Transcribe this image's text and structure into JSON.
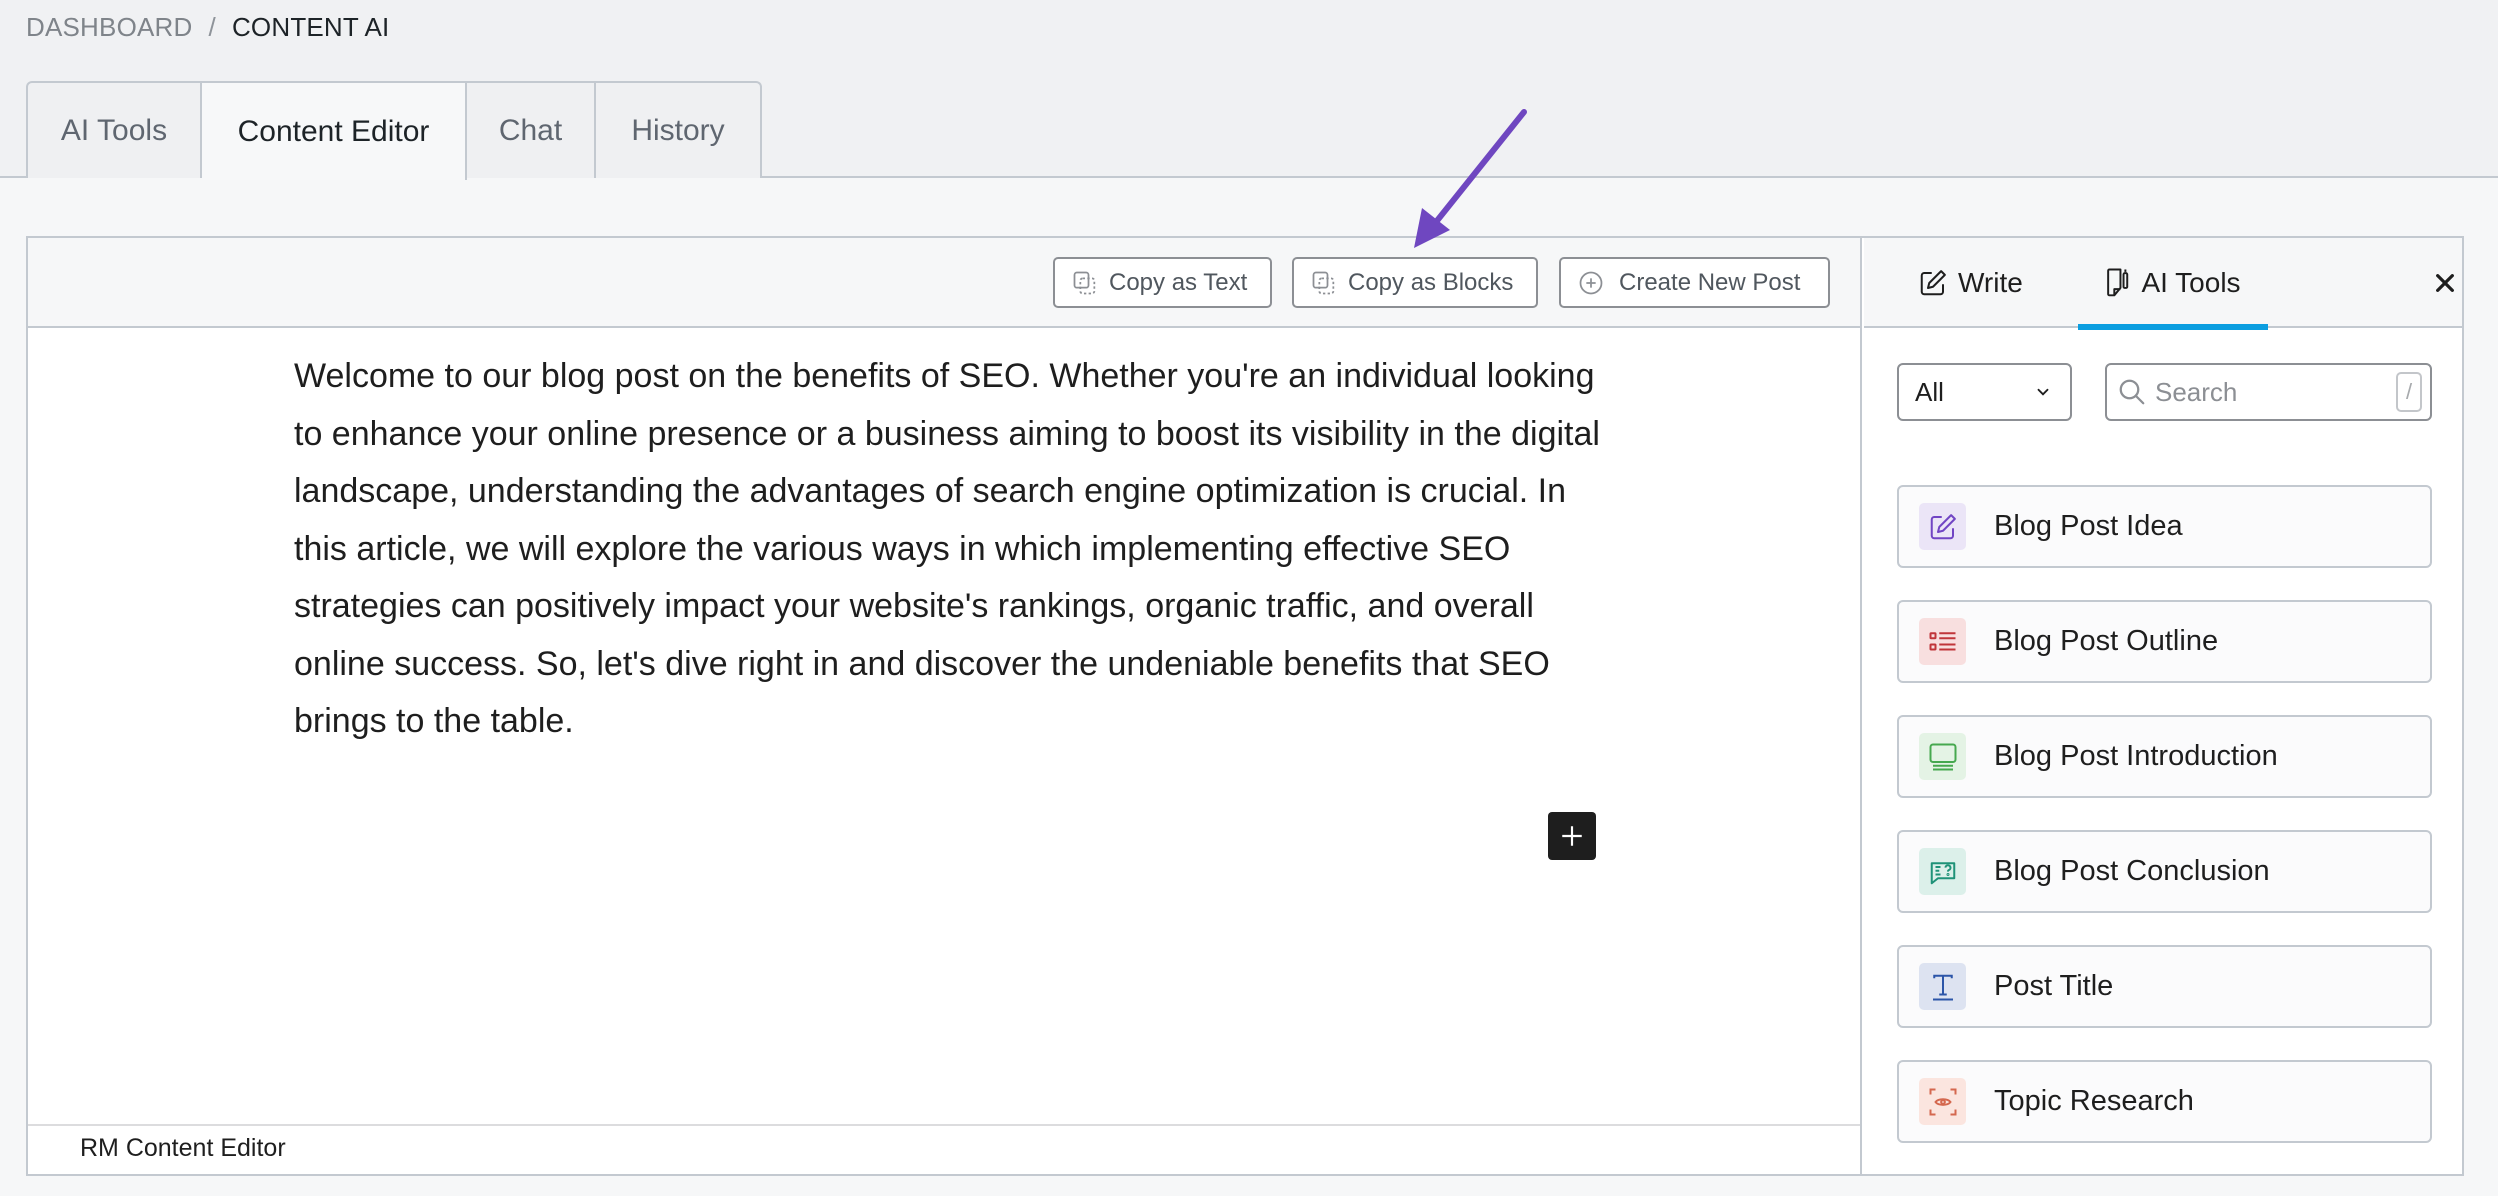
{
  "breadcrumb": {
    "parent": "DASHBOARD",
    "separator": "/",
    "current": "CONTENT AI"
  },
  "tabs": [
    {
      "label": "AI Tools",
      "active": false
    },
    {
      "label": "Content Editor",
      "active": true
    },
    {
      "label": "Chat",
      "active": false
    },
    {
      "label": "History",
      "active": false
    }
  ],
  "toolbar": {
    "copy_text_label": "Copy as Text",
    "copy_blocks_label": "Copy as Blocks",
    "new_post_label": "Create New Post"
  },
  "editor": {
    "paragraph": "Welcome to our blog post on the benefits of SEO. Whether you're an individual looking to enhance your online presence or a business aiming to boost its visibility in the digital landscape, understanding the advantages of search engine optimization is crucial. In this article, we will explore the various ways in which implementing effective SEO strategies can positively impact your website's rankings, organic traffic, and overall online success. So, let's dive right in and discover the undeniable benefits that SEO brings to the table.",
    "footer_label": "RM Content Editor"
  },
  "sidebar": {
    "tabs": [
      {
        "label": "Write",
        "icon": "edit-icon",
        "active": false
      },
      {
        "label": "AI Tools",
        "icon": "document-pen-icon",
        "active": true
      }
    ],
    "filter": {
      "selected": "All"
    },
    "search": {
      "placeholder": "Search",
      "value": "",
      "shortcut": "/"
    },
    "tools": [
      {
        "label": "Blog Post Idea",
        "icon": "edit-icon",
        "color": "#7145c4",
        "bg": "#ebe5f7"
      },
      {
        "label": "Blog Post Outline",
        "icon": "list-icon",
        "color": "#c0353a",
        "bg": "#f8dfdf"
      },
      {
        "label": "Blog Post Introduction",
        "icon": "monitor-icon",
        "color": "#46a84f",
        "bg": "#e4f3e5"
      },
      {
        "label": "Blog Post Conclusion",
        "icon": "chat-question-icon",
        "color": "#1f9278",
        "bg": "#dcf0ea"
      },
      {
        "label": "Post Title",
        "icon": "text-icon",
        "color": "#2c55a8",
        "bg": "#dde3f1"
      },
      {
        "label": "Topic Research",
        "icon": "eye-scan-icon",
        "color": "#d4684f",
        "bg": "#fbe5df"
      }
    ]
  },
  "colors": {
    "accent": "#0b9ee0",
    "annotation_arrow": "#6f47c0"
  }
}
